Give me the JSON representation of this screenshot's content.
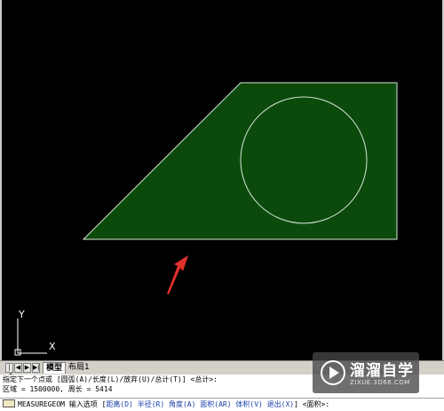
{
  "canvas": {
    "background": "#000000",
    "shape_fill": "#0b4a0b",
    "shape_stroke": "#d9e6d9",
    "arrow_color": "#e0302a",
    "ucs": {
      "y_label": "Y",
      "x_label": "X"
    }
  },
  "layout_tabs": {
    "nav_buttons": [
      "|◀",
      "◀",
      "▶",
      "▶|"
    ],
    "tabs": [
      "模型",
      "布局1"
    ]
  },
  "command_history": [
    "指定下一个点或 [圆弧(A)/长度(L)/放弃(U)/总计(T)] <总计>:",
    "区域 = 1500000, 周长 = 5414"
  ],
  "command_prompt": {
    "command": "MEASUREGEOM 输入选项 [",
    "options": [
      "距离(D)",
      "半径(R)",
      "角度(A)",
      "面积(AR)",
      "体积(V)",
      "退出(X)"
    ],
    "suffix": "] <面积>:"
  },
  "watermark": {
    "title": "溜溜自学",
    "url": "ZIXUE.3D66.COM"
  }
}
